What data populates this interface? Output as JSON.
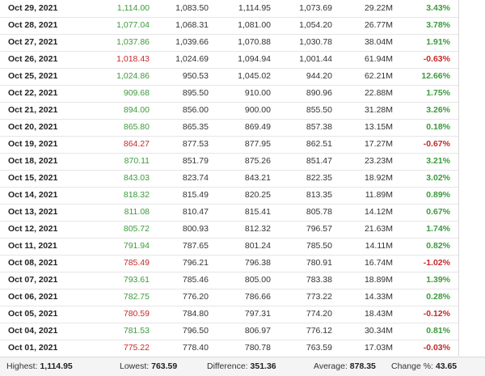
{
  "colors": {
    "up": "#3c9a3c",
    "down": "#c62828"
  },
  "rows": [
    {
      "date": "Oct 29, 2021",
      "price": "1,114.00",
      "open": "1,083.50",
      "high": "1,114.95",
      "low": "1,073.69",
      "vol": "29.22M",
      "chg": "3.43%",
      "dir": "up"
    },
    {
      "date": "Oct 28, 2021",
      "price": "1,077.04",
      "open": "1,068.31",
      "high": "1,081.00",
      "low": "1,054.20",
      "vol": "26.77M",
      "chg": "3.78%",
      "dir": "up"
    },
    {
      "date": "Oct 27, 2021",
      "price": "1,037.86",
      "open": "1,039.66",
      "high": "1,070.88",
      "low": "1,030.78",
      "vol": "38.04M",
      "chg": "1.91%",
      "dir": "up"
    },
    {
      "date": "Oct 26, 2021",
      "price": "1,018.43",
      "open": "1,024.69",
      "high": "1,094.94",
      "low": "1,001.44",
      "vol": "61.94M",
      "chg": "-0.63%",
      "dir": "down"
    },
    {
      "date": "Oct 25, 2021",
      "price": "1,024.86",
      "open": "950.53",
      "high": "1,045.02",
      "low": "944.20",
      "vol": "62.21M",
      "chg": "12.66%",
      "dir": "up"
    },
    {
      "date": "Oct 22, 2021",
      "price": "909.68",
      "open": "895.50",
      "high": "910.00",
      "low": "890.96",
      "vol": "22.88M",
      "chg": "1.75%",
      "dir": "up"
    },
    {
      "date": "Oct 21, 2021",
      "price": "894.00",
      "open": "856.00",
      "high": "900.00",
      "low": "855.50",
      "vol": "31.28M",
      "chg": "3.26%",
      "dir": "up"
    },
    {
      "date": "Oct 20, 2021",
      "price": "865.80",
      "open": "865.35",
      "high": "869.49",
      "low": "857.38",
      "vol": "13.15M",
      "chg": "0.18%",
      "dir": "up"
    },
    {
      "date": "Oct 19, 2021",
      "price": "864.27",
      "open": "877.53",
      "high": "877.95",
      "low": "862.51",
      "vol": "17.27M",
      "chg": "-0.67%",
      "dir": "down"
    },
    {
      "date": "Oct 18, 2021",
      "price": "870.11",
      "open": "851.79",
      "high": "875.26",
      "low": "851.47",
      "vol": "23.23M",
      "chg": "3.21%",
      "dir": "up"
    },
    {
      "date": "Oct 15, 2021",
      "price": "843.03",
      "open": "823.74",
      "high": "843.21",
      "low": "822.35",
      "vol": "18.92M",
      "chg": "3.02%",
      "dir": "up"
    },
    {
      "date": "Oct 14, 2021",
      "price": "818.32",
      "open": "815.49",
      "high": "820.25",
      "low": "813.35",
      "vol": "11.89M",
      "chg": "0.89%",
      "dir": "up"
    },
    {
      "date": "Oct 13, 2021",
      "price": "811.08",
      "open": "810.47",
      "high": "815.41",
      "low": "805.78",
      "vol": "14.12M",
      "chg": "0.67%",
      "dir": "up"
    },
    {
      "date": "Oct 12, 2021",
      "price": "805.72",
      "open": "800.93",
      "high": "812.32",
      "low": "796.57",
      "vol": "21.63M",
      "chg": "1.74%",
      "dir": "up"
    },
    {
      "date": "Oct 11, 2021",
      "price": "791.94",
      "open": "787.65",
      "high": "801.24",
      "low": "785.50",
      "vol": "14.11M",
      "chg": "0.82%",
      "dir": "up"
    },
    {
      "date": "Oct 08, 2021",
      "price": "785.49",
      "open": "796.21",
      "high": "796.38",
      "low": "780.91",
      "vol": "16.74M",
      "chg": "-1.02%",
      "dir": "down"
    },
    {
      "date": "Oct 07, 2021",
      "price": "793.61",
      "open": "785.46",
      "high": "805.00",
      "low": "783.38",
      "vol": "18.89M",
      "chg": "1.39%",
      "dir": "up"
    },
    {
      "date": "Oct 06, 2021",
      "price": "782.75",
      "open": "776.20",
      "high": "786.66",
      "low": "773.22",
      "vol": "14.33M",
      "chg": "0.28%",
      "dir": "up"
    },
    {
      "date": "Oct 05, 2021",
      "price": "780.59",
      "open": "784.80",
      "high": "797.31",
      "low": "774.20",
      "vol": "18.43M",
      "chg": "-0.12%",
      "dir": "down"
    },
    {
      "date": "Oct 04, 2021",
      "price": "781.53",
      "open": "796.50",
      "high": "806.97",
      "low": "776.12",
      "vol": "30.34M",
      "chg": "0.81%",
      "dir": "up"
    },
    {
      "date": "Oct 01, 2021",
      "price": "775.22",
      "open": "778.40",
      "high": "780.78",
      "low": "763.59",
      "vol": "17.03M",
      "chg": "-0.03%",
      "dir": "down"
    }
  ],
  "summary": {
    "highest_label": "Highest:",
    "highest_value": "1,114.95",
    "lowest_label": "Lowest:",
    "lowest_value": "763.59",
    "difference_label": "Difference:",
    "difference_value": "351.36",
    "average_label": "Average:",
    "average_value": "878.35",
    "change_label": "Change %:",
    "change_value": "43.65"
  }
}
